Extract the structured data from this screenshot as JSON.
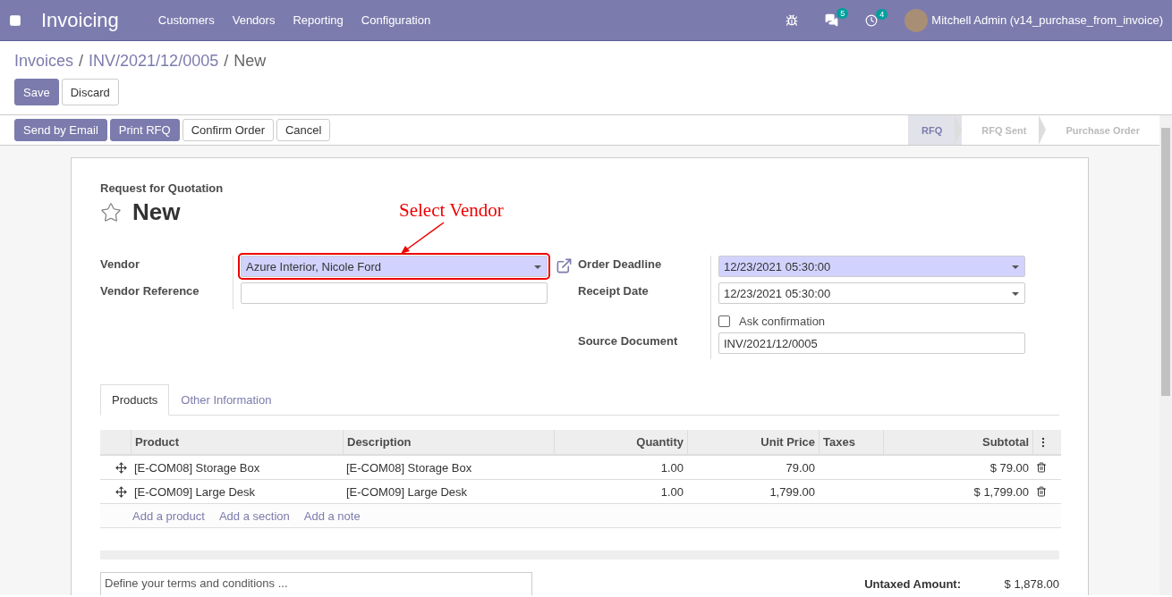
{
  "navbar": {
    "app_name": "Invoicing",
    "menu": [
      "Customers",
      "Vendors",
      "Reporting",
      "Configuration"
    ],
    "messages_count": "5",
    "activities_count": "4",
    "user": "Mitchell Admin (v14_purchase_from_invoice)"
  },
  "breadcrumb": [
    {
      "label": "Invoices",
      "kind": "link"
    },
    {
      "label": "/",
      "kind": "separator"
    },
    {
      "label": "INV/2021/12/0005",
      "kind": "link"
    },
    {
      "label": "/",
      "kind": "separator"
    },
    {
      "label": "New",
      "kind": "current"
    }
  ],
  "actions": [
    {
      "label": "Save",
      "primary": true
    },
    {
      "label": "Discard",
      "primary": false
    }
  ],
  "header_buttons": [
    {
      "label": "Send by Email",
      "primary": true
    },
    {
      "label": "Print RFQ",
      "primary": true
    },
    {
      "label": "Confirm Order",
      "primary": false
    },
    {
      "label": "Cancel",
      "primary": false
    }
  ],
  "stages": [
    {
      "label": "RFQ",
      "selected": true
    },
    {
      "label": "RFQ Sent",
      "selected": false
    },
    {
      "label": "Purchase Order",
      "selected": false
    }
  ],
  "form": {
    "subtitle": "Request for Quotation",
    "title": "New",
    "starred": false,
    "annotation": "Select Vendor",
    "left_fields": [
      {
        "label": "Vendor",
        "kind": "select",
        "value": "Azure Interior, Nicole Ford",
        "required": true,
        "highlighted": true
      },
      {
        "label": "Vendor Reference",
        "kind": "input",
        "required": false,
        "highlighted": false
      }
    ],
    "right_fields": [
      {
        "label": "Order Deadline",
        "kind": "select",
        "value": "12/23/2021 05:30:00",
        "required": true
      },
      {
        "label": "Receipt Date",
        "kind": "select",
        "value": "12/23/2021 05:30:00",
        "required": false
      },
      {
        "label": "Ask confirmation",
        "kind": "checkbox",
        "checked": false
      },
      {
        "label": "Source Document",
        "kind": "input",
        "value": "INV/2021/12/0005",
        "required": false
      }
    ]
  },
  "tabs": [
    {
      "label": "Products",
      "selected": true
    },
    {
      "label": "Other Information",
      "selected": false
    }
  ],
  "table": {
    "columns": [
      "Product",
      "Description",
      "Quantity",
      "Unit Price",
      "Taxes",
      "Subtotal"
    ],
    "rows": [
      {
        "product": "[E-COM08] Storage Box",
        "description": "[E-COM08] Storage Box",
        "quantity": "1.00",
        "unit_price": "79.00",
        "subtotal": "$ 79.00"
      },
      {
        "product": "[E-COM09] Large Desk",
        "description": "[E-COM09] Large Desk",
        "quantity": "1.00",
        "unit_price": "1,799.00",
        "subtotal": "$ 1,799.00"
      }
    ],
    "add_links": [
      "Add a product",
      "Add a section",
      "Add a note"
    ]
  },
  "terms": {
    "placeholder": "Define your terms and conditions ..."
  },
  "totals": [
    {
      "label": "Untaxed Amount:",
      "value": "$ 1,878.00"
    }
  ]
}
